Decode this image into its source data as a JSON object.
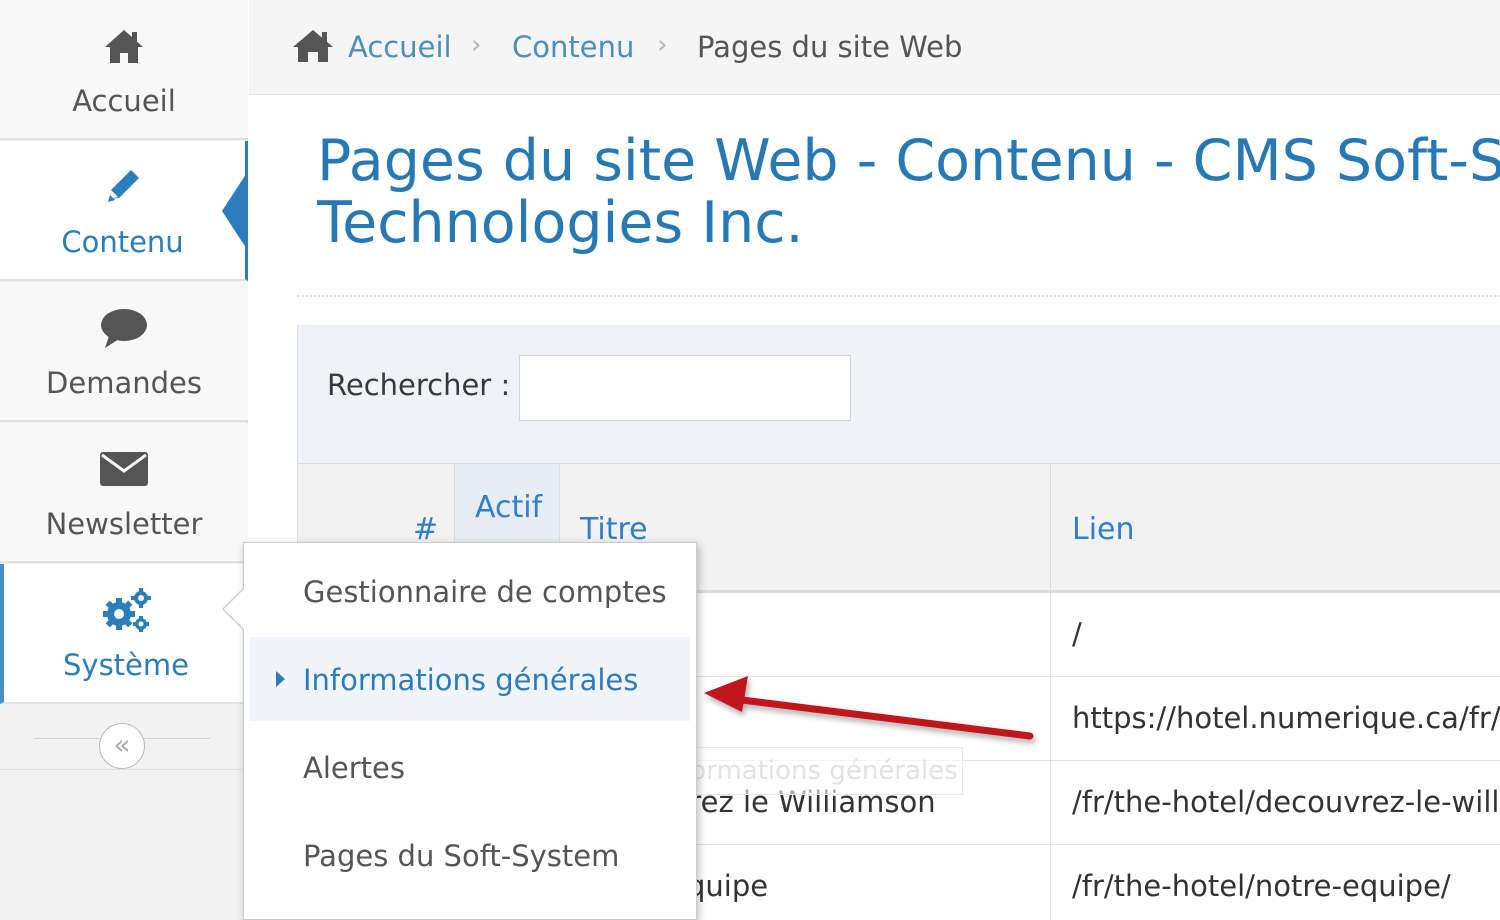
{
  "sidebar": {
    "items": [
      {
        "label": "Accueil",
        "icon": "home-icon"
      },
      {
        "label": "Contenu",
        "icon": "pencil-icon"
      },
      {
        "label": "Demandes",
        "icon": "comment-icon"
      },
      {
        "label": "Newsletter",
        "icon": "envelope-icon"
      },
      {
        "label": "Système",
        "icon": "cogs-icon"
      }
    ],
    "active_item": "Contenu",
    "open_item": "Système",
    "collapse_glyph": "«"
  },
  "breadcrumb": {
    "items": [
      "Accueil",
      "Contenu"
    ],
    "current": "Pages du site Web",
    "separator": "›"
  },
  "page": {
    "title_line1": "Pages du site Web - Contenu - CMS Soft-Syste",
    "title_line2": "Technologies Inc."
  },
  "search": {
    "label": "Rechercher :",
    "value": "",
    "placeholder": ""
  },
  "table": {
    "columns": [
      "#",
      "Actif",
      "Titre",
      "Lien"
    ],
    "rows": [
      {
        "titre": "",
        "lien": "/"
      },
      {
        "titre": "",
        "lien": "https://hotel.numerique.ca/fr/"
      },
      {
        "titre": "Découvrez le Williamson",
        "lien": "/fr/the-hotel/decouvrez-le-williamson/"
      },
      {
        "titre": "Notre équipe",
        "lien": "/fr/the-hotel/notre-equipe/"
      }
    ]
  },
  "submenu": {
    "items": [
      "Gestionnaire de comptes",
      "Informations générales",
      "Alertes",
      "Pages du Soft-System"
    ],
    "highlighted": "Informations générales"
  },
  "tooltip": {
    "text": "Informations générales"
  },
  "colors": {
    "accent": "#2b7dbc",
    "link": "#4c8fbd",
    "title": "#2679b5",
    "arrow": "#c0161c"
  }
}
